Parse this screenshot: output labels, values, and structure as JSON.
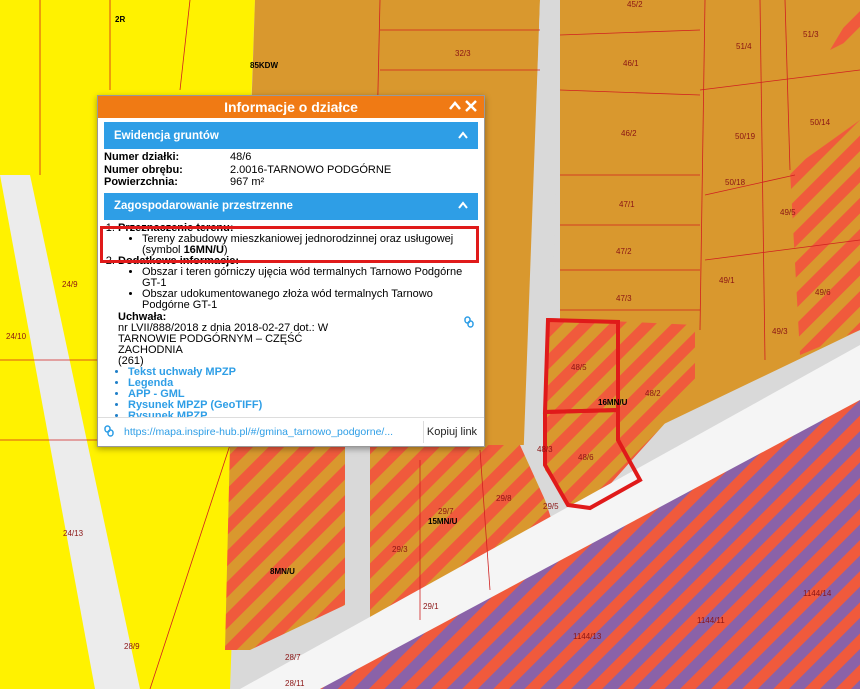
{
  "popup": {
    "title": "Informacje o działce",
    "section1": "Ewidencja gruntów",
    "fields": [
      {
        "key": "Numer działki:",
        "value": "48/6"
      },
      {
        "key": "Numer obrębu:",
        "value": "2.0016-TARNOWO PODGÓRNE"
      },
      {
        "key": "Powierzchnia:",
        "value": "967 m²"
      }
    ],
    "section2": "Zagospodarowanie przestrzenne",
    "item1_title": "Przeznaczenie terenu:",
    "item1_text_a": "Tereny zabudowy mieszkaniowej jednorodzinnej oraz usługowej",
    "item1_text_b": "(symbol ",
    "item1_symbol": "16MN/U",
    "item1_text_c": ")",
    "item2_title": "Dodatkowe informacje:",
    "item2_bullets": [
      "Obszar i teren górniczy ujęcia wód termalnych Tarnowo Podgórne GT-1",
      "Obszar udokumentowanego złoża wód termalnych Tarnowo Podgórne GT-1"
    ],
    "uchwala_label": "Uchwała:",
    "uchwala_text": "nr LVII/888/2018 z dnia 2018-02-27 dot.: W TARNOWIE PODGÓRNYM – CZĘŚĆ ZACHODNIA",
    "uchwala_num": "(261)",
    "links": [
      "Tekst uchwały MPZP",
      "Legenda",
      "APP - GML",
      "Rysunek MPZP (GeoTIFF)",
      "Rysunek MPZP"
    ],
    "url": "https://mapa.inspire-hub.pl/#/gmina_tarnowo_podgorne/...",
    "copy_label": "Kopiuj link"
  },
  "map": {
    "parcel_labels": [
      "45/2",
      "2R",
      "32/3",
      "46/1",
      "51/4",
      "51/3",
      "85KDW",
      "46/2",
      "50/19",
      "50/14",
      "47/1",
      "50/18",
      "49/5",
      "47/2",
      "49/1",
      "49/6",
      "47/3",
      "49/3",
      "24/9",
      "24/10",
      "48/5",
      "48/2",
      "16MN/U",
      "48/3",
      "48/6",
      "29/5",
      "29/7",
      "29/8",
      "15MN/U",
      "29/3",
      "24/13",
      "8MN/U",
      "29/1",
      "1144/13",
      "1144/11",
      "1144/14",
      "28/9",
      "28/7",
      "28/11"
    ]
  },
  "colors": {
    "yellow": "#fff200",
    "orange": "#d9982e",
    "road": "#d9d9d9",
    "purple": "#8a62a8",
    "stripe": "#f05a3c",
    "accent": "#f07a14",
    "bar": "#2e9ee6",
    "highlight": "#e01a1a"
  }
}
